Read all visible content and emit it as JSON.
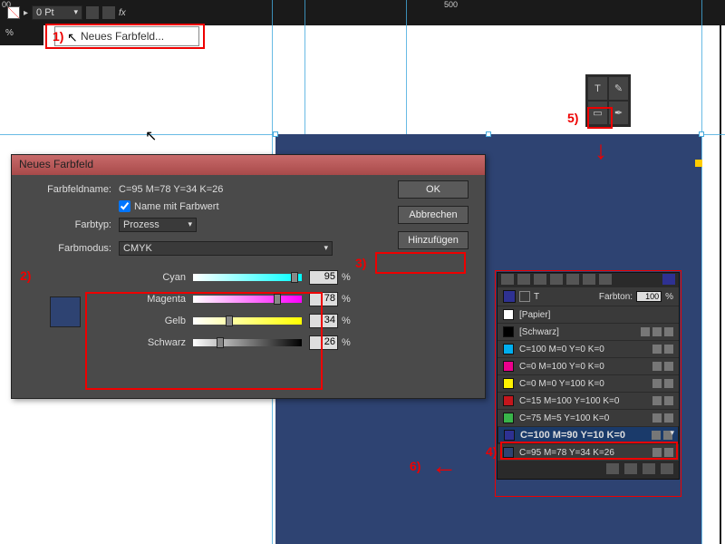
{
  "ruler": {
    "m0": "00",
    "m500": "500"
  },
  "step_labels": {
    "s1": "1)",
    "s2": "2)",
    "s3": "3)",
    "s4": "4)",
    "s5": "5)",
    "s6": "6)"
  },
  "menu_item": "Neues Farbfeld...",
  "dialog": {
    "title": "Neues Farbfeld",
    "name_label": "Farbfeldname:",
    "name_value": "C=95 M=78 Y=34 K=26",
    "name_with_value_chk": "Name mit Farbwert",
    "type_label": "Farbtyp:",
    "type_value": "Prozess",
    "mode_label": "Farbmodus:",
    "mode_value": "CMYK",
    "sliders": {
      "cyan": {
        "label": "Cyan",
        "value": "95",
        "pct": "%"
      },
      "magenta": {
        "label": "Magenta",
        "value": "78",
        "pct": "%"
      },
      "yellow": {
        "label": "Gelb",
        "value": "34",
        "pct": "%"
      },
      "black": {
        "label": "Schwarz",
        "value": "26",
        "pct": "%"
      }
    },
    "buttons": {
      "ok": "OK",
      "cancel": "Abbrechen",
      "add": "Hinzufügen"
    }
  },
  "toolbar_small": {
    "pt": "0 Pt",
    "pct": "%"
  },
  "panel": {
    "tint_label": "Farbton:",
    "tint_value": "100",
    "tint_pct": "%",
    "rows": [
      {
        "name": "[Papier]",
        "color": "#ffffff"
      },
      {
        "name": "[Schwarz]",
        "color": "#000000"
      },
      {
        "name": "C=100 M=0 Y=0 K=0",
        "color": "#00aeef"
      },
      {
        "name": "C=0 M=100 Y=0 K=0",
        "color": "#ec008c"
      },
      {
        "name": "C=0 M=0 Y=100 K=0",
        "color": "#fff200"
      },
      {
        "name": "C=15 M=100 Y=100 K=0",
        "color": "#c4161c"
      },
      {
        "name": "C=75 M=5 Y=100 K=0",
        "color": "#39b54a"
      },
      {
        "name": "C=100 M=90 Y=10 K=0",
        "color": "#2e3192",
        "selected": true
      },
      {
        "name": "C=95 M=78 Y=34 K=26",
        "color": "#2e4372"
      }
    ]
  },
  "flyout_icons": {
    "type": "T",
    "eyedrop": "✎",
    "rect": "▭",
    "pen": "✒"
  }
}
